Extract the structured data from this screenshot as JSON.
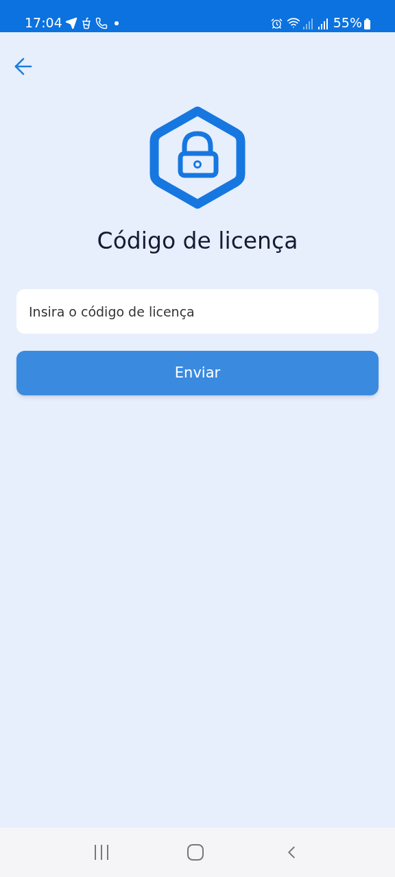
{
  "status_bar": {
    "time": "17:04",
    "battery": "55%"
  },
  "title": "Código de licença",
  "license_field": {
    "placeholder": "Insira o código de licença"
  },
  "submit_button": {
    "label": "Enviar"
  }
}
